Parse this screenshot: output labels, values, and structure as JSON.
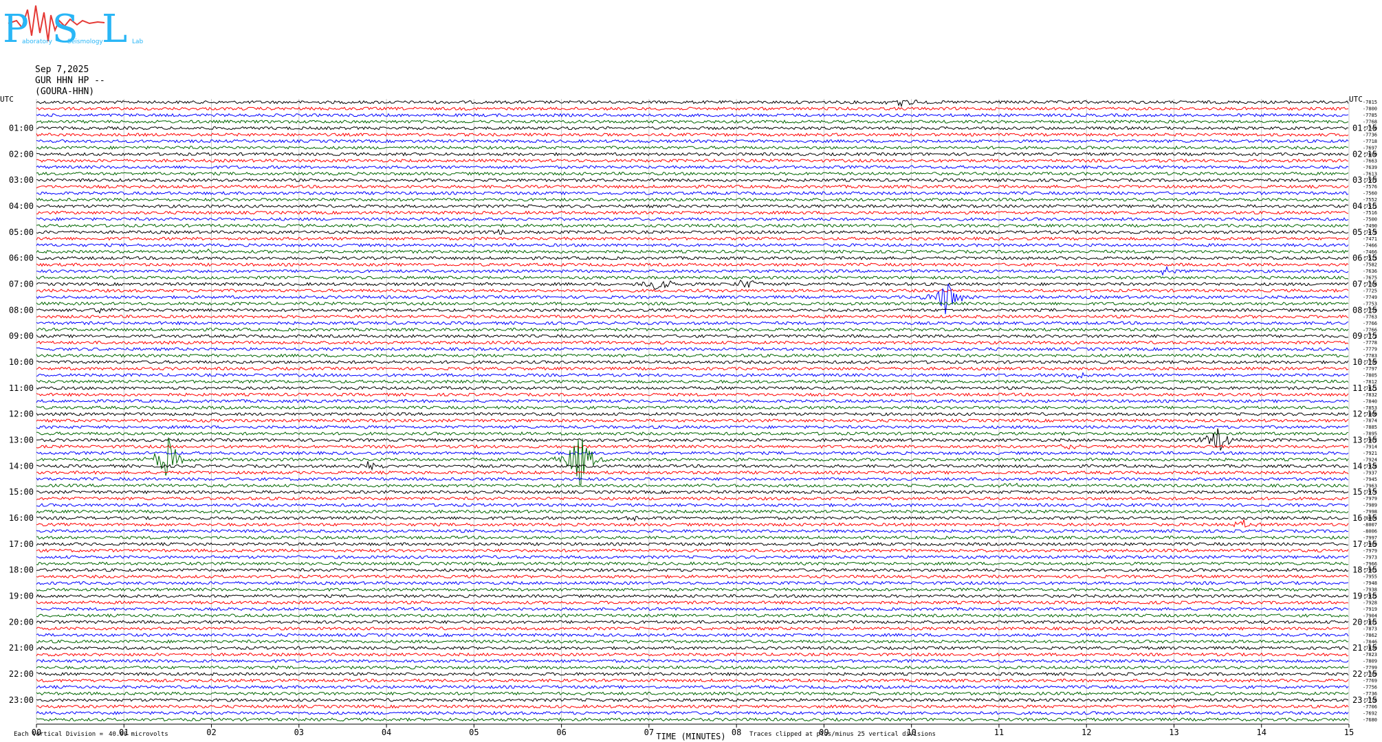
{
  "logo": {
    "big": "PSL",
    "small": [
      "aboratory",
      "Seismology",
      "Lab"
    ]
  },
  "header": {
    "date": "Sep 7,2025",
    "station": "GUR HHN HP --",
    "network": "(GOURA-HHN)"
  },
  "chart_data": {
    "type": "helicorder",
    "utc_label": "UTC",
    "left_hour_labels": [
      "01:00",
      "02:00",
      "03:00",
      "04:00",
      "05:00",
      "06:00",
      "07:00",
      "08:00",
      "09:00",
      "10:00",
      "11:00",
      "12:00",
      "13:00",
      "14:00",
      "15:00",
      "16:00",
      "17:00",
      "18:00",
      "19:00",
      "20:00",
      "21:00",
      "22:00",
      "23:00"
    ],
    "right_hour_labels": [
      "01:15",
      "02:15",
      "03:15",
      "04:15",
      "05:15",
      "06:15",
      "07:15",
      "08:15",
      "09:15",
      "10:15",
      "11:15",
      "12:15",
      "13:15",
      "14:15",
      "15:15",
      "16:15",
      "17:15",
      "18:15",
      "19:15",
      "20:15",
      "21:15",
      "22:15",
      "23:15"
    ],
    "x_ticks": [
      "00",
      "01",
      "02",
      "03",
      "04",
      "05",
      "06",
      "07",
      "08",
      "09",
      "10",
      "11",
      "12",
      "13",
      "14",
      "15"
    ],
    "xlabel": "TIME (MINUTES)",
    "xlim": [
      0,
      15
    ],
    "traces_per_hour": 4,
    "trace_colors": [
      "#000000",
      "#ff0000",
      "#0000ff",
      "#006600"
    ],
    "right_values": [
      "-7815",
      "-7800",
      "-7785",
      "-7768",
      "-7740",
      "-7736",
      "-7718",
      "-7697",
      "-7680",
      "-7663",
      "-7639",
      "-7613",
      "-7597",
      "-7576",
      "-7560",
      "-7552",
      "-7531",
      "-7516",
      "-7500",
      "-7490",
      "-7478",
      "-7471",
      "-7466",
      "-7466",
      "-7513",
      "-7582",
      "-7636",
      "-7675",
      "-7704",
      "-7725",
      "-7749",
      "-7753",
      "-7759",
      "-7763",
      "-7766",
      "-7766",
      "-7772",
      "-7778",
      "-7779",
      "-7783",
      "-7790",
      "-7797",
      "-7805",
      "-7812",
      "-7821",
      "-7832",
      "-7840",
      "-7853",
      "-7860",
      "-7874",
      "-7885",
      "-7895",
      "-7907",
      "-7914",
      "-7921",
      "-7924",
      "-7928",
      "-7937",
      "-7945",
      "-7963",
      "-7974",
      "-7979",
      "-7989",
      "-7998",
      "-8004",
      "-8007",
      "-8006",
      "-7997",
      "-7989",
      "-7979",
      "-7973",
      "-7966",
      "-7961",
      "-7955",
      "-7948",
      "-7938",
      "-7935",
      "-7928",
      "-7919",
      "-7904",
      "-7891",
      "-7873",
      "-7862",
      "-7846",
      "-7830",
      "-7823",
      "-7809",
      "-7799",
      "-7789",
      "-7769",
      "-7756",
      "-7736",
      "-7718",
      "-7706",
      "-7692",
      "-7680"
    ],
    "events": [
      {
        "trace": 0,
        "minute": 9.9,
        "amplitude": 9
      },
      {
        "trace": 20,
        "minute": 5.3,
        "amplitude": 4
      },
      {
        "trace": 23,
        "minute": 1.9,
        "amplitude": 5
      },
      {
        "trace": 26,
        "minute": 12.9,
        "amplitude": 8
      },
      {
        "trace": 28,
        "minute": 7.1,
        "amplitude": 16
      },
      {
        "trace": 28,
        "minute": 8.1,
        "amplitude": 10
      },
      {
        "trace": 30,
        "minute": 10.4,
        "amplitude": 30
      },
      {
        "trace": 32,
        "minute": 0.7,
        "amplitude": 4
      },
      {
        "trace": 42,
        "minute": 11.9,
        "amplitude": 6
      },
      {
        "trace": 52,
        "minute": 13.5,
        "amplitude": 24
      },
      {
        "trace": 53,
        "minute": 11.8,
        "amplitude": 10
      },
      {
        "trace": 55,
        "minute": 1.5,
        "amplitude": 35
      },
      {
        "trace": 55,
        "minute": 6.2,
        "amplitude": 50
      },
      {
        "trace": 56,
        "minute": 3.8,
        "amplitude": 6
      },
      {
        "trace": 59,
        "minute": 11.1,
        "amplitude": 5
      },
      {
        "trace": 64,
        "minute": 6.8,
        "amplitude": 4
      },
      {
        "trace": 65,
        "minute": 13.8,
        "amplitude": 6
      }
    ]
  },
  "footer": {
    "division_label": "Each Vertical Division =",
    "division_value": "40.00 microvolts",
    "clip_note": "Traces clipped at plus/minus 25 vertical divisions"
  }
}
